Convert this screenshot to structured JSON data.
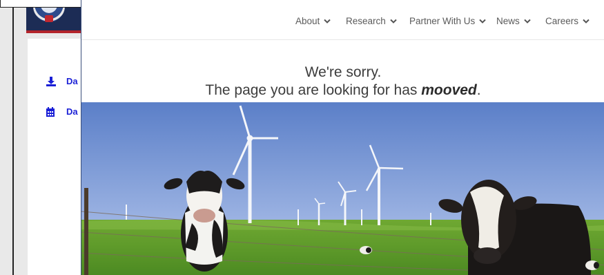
{
  "background_window": {
    "panel_items": [
      {
        "label": "Da",
        "icon": "download-icon"
      },
      {
        "label": "Da",
        "icon": "calendar-icon"
      }
    ]
  },
  "nav": {
    "items": [
      {
        "label": "About",
        "icon": "chevron-down-icon"
      },
      {
        "label": "Research",
        "icon": "chevron-down-icon"
      },
      {
        "label": "Partner With Us",
        "icon": "chevron-down-icon"
      },
      {
        "label": "News",
        "icon": "chevron-down-icon"
      },
      {
        "label": "Careers",
        "icon": "chevron-down-icon"
      }
    ]
  },
  "message": {
    "line1": "We're sorry.",
    "line2_prefix": "The page you are looking for has ",
    "line2_emphasis": "mooved",
    "line2_suffix": "."
  },
  "colors": {
    "panel_link": "#1a1fd6",
    "logo_navy": "#1c2c55",
    "logo_red": "#b3242b",
    "nav_text": "#5a5a5a"
  }
}
